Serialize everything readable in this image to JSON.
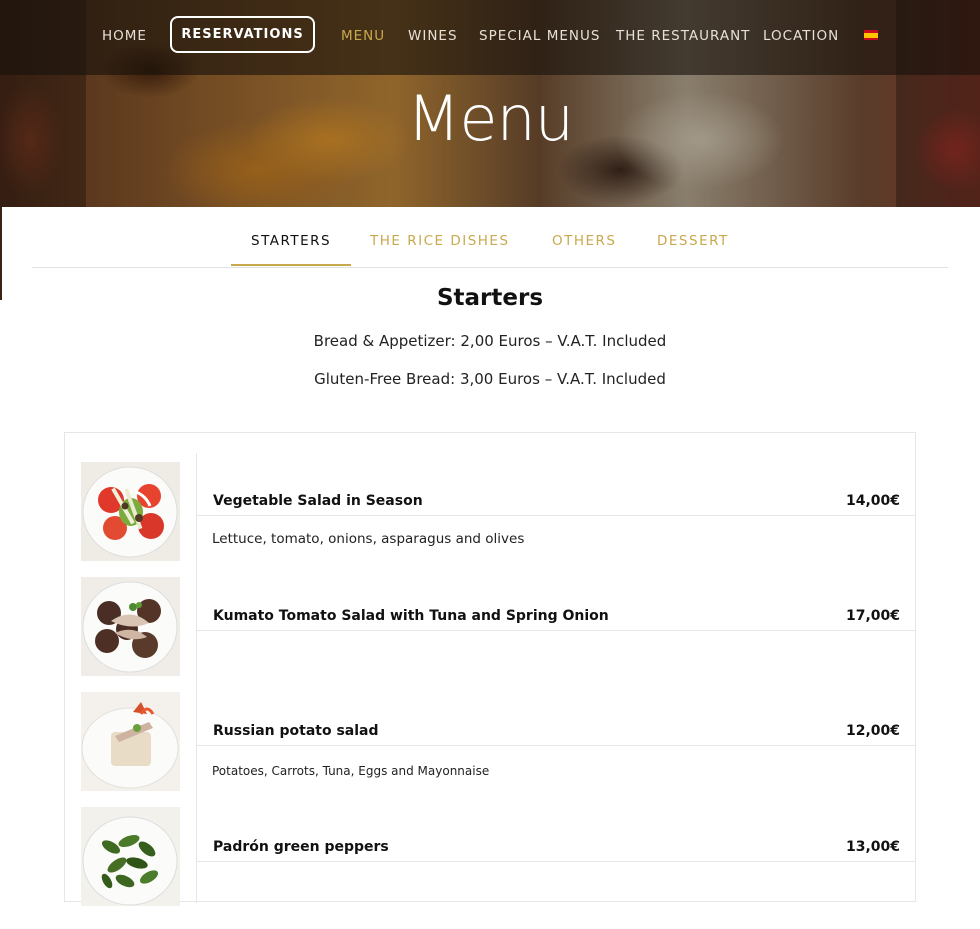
{
  "nav": {
    "home": "HOME",
    "reservations": "RESERVATIONS",
    "menu": "MENU",
    "wines": "WINES",
    "special_menus": "SPECIAL MENUS",
    "the_restaurant": "THE RESTAURANT",
    "location": "LOCATION",
    "language_icon": "spanish-flag-icon",
    "active": "MENU"
  },
  "hero": {
    "title": "Menu"
  },
  "tabs": {
    "items": [
      "STARTERS",
      "THE RICE DISHES",
      "OTHERS",
      "DESSERT"
    ],
    "active": "STARTERS"
  },
  "section": {
    "title": "Starters",
    "notes": [
      "Bread & Appetizer: 2,00 Euros – V.A.T. Included",
      "Gluten-Free Bread: 3,00 Euros – V.A.T. Included"
    ]
  },
  "dishes": [
    {
      "name": "Vegetable Salad in Season",
      "price": "14,00€",
      "description": "Lettuce, tomato, onions, asparagus and olives"
    },
    {
      "name": "Kumato Tomato Salad with Tuna and Spring Onion",
      "price": "17,00€",
      "description": ""
    },
    {
      "name": "Russian potato salad",
      "price": "12,00€",
      "description": "Potatoes, Carrots, Tuna, Eggs and Mayonnaise"
    },
    {
      "name": "Padrón green peppers",
      "price": "13,00€",
      "description": ""
    }
  ],
  "colors": {
    "accent": "#c9a94e",
    "text": "#111111",
    "nav_text": "#e6e0d6",
    "divider": "#e6e6e6"
  }
}
